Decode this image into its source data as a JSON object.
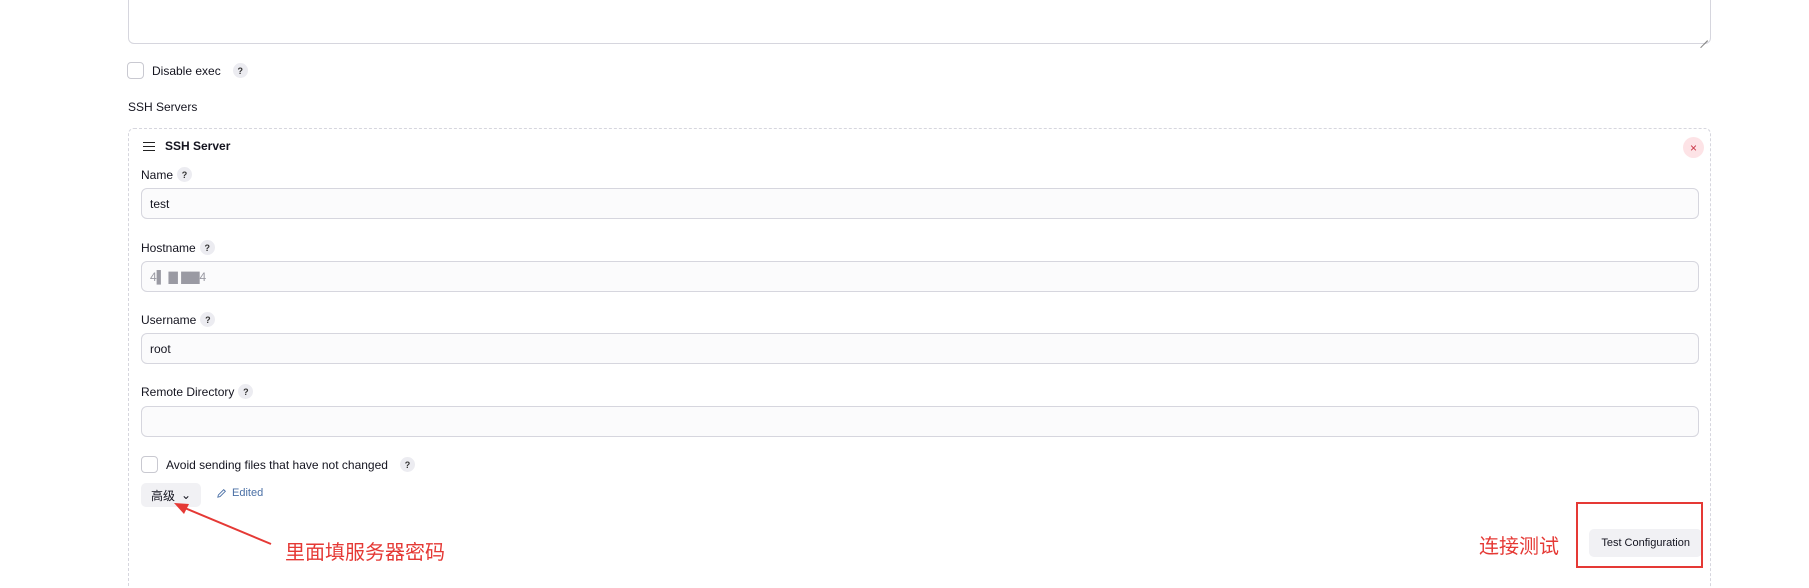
{
  "disable_exec": {
    "label": "Disable exec",
    "help": "?"
  },
  "ssh_servers": {
    "section_label": "SSH Servers",
    "server": {
      "title": "SSH Server",
      "close": "×",
      "fields": {
        "name": {
          "label": "Name",
          "help": "?",
          "value": "test"
        },
        "hostname": {
          "label": "Hostname",
          "help": "?",
          "value": "4▌ ▇   ▇▇4"
        },
        "username": {
          "label": "Username",
          "help": "?",
          "value": "root"
        },
        "remote_directory": {
          "label": "Remote Directory",
          "help": "?",
          "value": ""
        }
      },
      "avoid_sending": {
        "label": "Avoid sending files that have not changed",
        "help": "?"
      },
      "advanced": {
        "label": "高级",
        "chevron": "⌄"
      },
      "edited": {
        "label": "Edited"
      },
      "test_configuration": {
        "label": "Test Configuration"
      }
    }
  },
  "annotations": {
    "password_hint": "里面填服务器密码",
    "test_hint": "连接测试",
    "color": "#e53935"
  }
}
